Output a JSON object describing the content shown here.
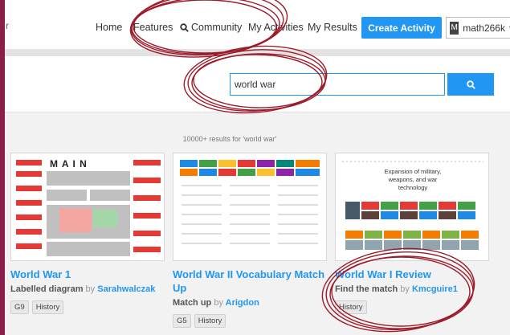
{
  "nav": {
    "edge_text": "r",
    "home": "Home",
    "features": "Features",
    "community": "Community",
    "activities": "My Activities",
    "results": "My Results",
    "create": "Create Activity",
    "user_initial": "M",
    "username": "math266k",
    "user_caret": "▾"
  },
  "search": {
    "query": "world war",
    "button_icon": "search-icon"
  },
  "results_count": "10000+ results for 'world war'",
  "cards": [
    {
      "title": "World War 1",
      "type": "Labelled diagram",
      "by": "by",
      "author": "Sarahwalczak",
      "tags": [
        "G9",
        "History"
      ],
      "thumb_heading": "M   A   I   N"
    },
    {
      "title": "World War II Vocabulary Match Up",
      "type": "Match up",
      "by": "by",
      "author": "Arigdon",
      "tags": [
        "G5",
        "History"
      ]
    },
    {
      "title": "World War I Review",
      "type": "Find the match",
      "by": "by",
      "author": "Kmcguire1",
      "tags": [
        "History"
      ],
      "thumb_heading": "Expansion of military, weapons, and war technology"
    }
  ],
  "colors": {
    "accent": "#2196f3",
    "frame": "#8a1f4e",
    "annotation": "#9b1b2a"
  }
}
